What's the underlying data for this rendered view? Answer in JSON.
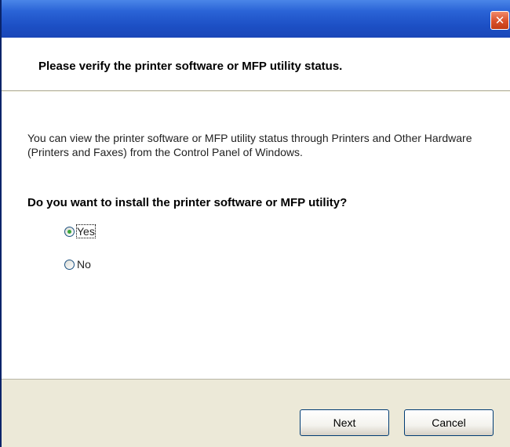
{
  "dialog": {
    "close_label": "✕"
  },
  "header": {
    "title": "Please verify the printer software or MFP utility status."
  },
  "content": {
    "description": "You can view the printer software or MFP utility status through Printers and Other Hardware (Printers and Faxes) from the Control Panel of Windows.",
    "question": "Do you want to install the printer software or MFP utility?",
    "options": [
      {
        "label": "Yes",
        "selected": true
      },
      {
        "label": "No",
        "selected": false
      }
    ]
  },
  "footer": {
    "next_label": "Next",
    "cancel_label": "Cancel"
  },
  "colors": {
    "titlebar": "#2a63d6",
    "close_button": "#d9502a",
    "dialog_bg": "#ece9d8"
  }
}
